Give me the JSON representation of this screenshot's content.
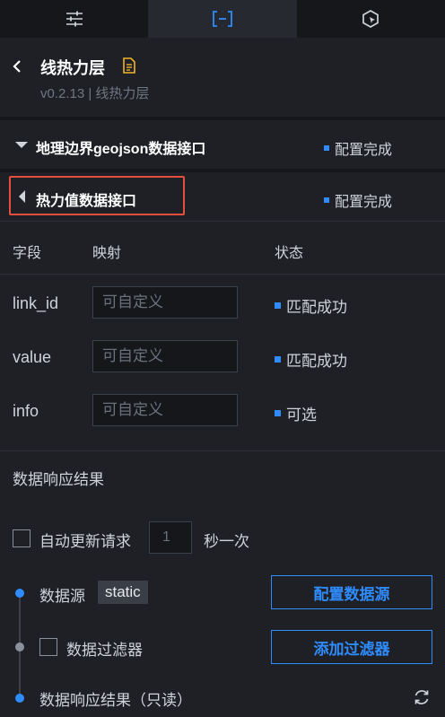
{
  "colors": {
    "accent": "#2f8cff",
    "highlight_border": "#e2503c",
    "doc_icon": "#f0b429"
  },
  "tabs": [
    {
      "icon": "sliders-icon",
      "active": false
    },
    {
      "icon": "bracket-box-icon",
      "active": true
    },
    {
      "icon": "hexagon-cursor-icon",
      "active": false
    }
  ],
  "header": {
    "title": "线热力层",
    "version": "v0.2.13 | 线热力层"
  },
  "sections": [
    {
      "label": "地理边界geojson数据接口",
      "status": "配置完成",
      "icon": "chevron-down-icon"
    },
    {
      "label": "热力值数据接口",
      "status": "配置完成",
      "icon": "chevron-left-icon"
    }
  ],
  "table": {
    "headers": [
      "字段",
      "映射",
      "状态"
    ],
    "rows": [
      {
        "field": "link_id",
        "placeholder": "可自定义",
        "status": "匹配成功"
      },
      {
        "field": "value",
        "placeholder": "可自定义",
        "status": "匹配成功"
      },
      {
        "field": "info",
        "placeholder": "可自定义",
        "status": "可选"
      }
    ]
  },
  "response": {
    "title": "数据响应结果",
    "auto_update_label": "自动更新请求",
    "interval_value": "1",
    "interval_unit": "秒一次",
    "datasource_label": "数据源",
    "datasource_tag": "static",
    "config_datasource_btn": "配置数据源",
    "filter_label": "数据过滤器",
    "add_filter_btn": "添加过滤器",
    "result_label": "数据响应结果（只读）"
  }
}
